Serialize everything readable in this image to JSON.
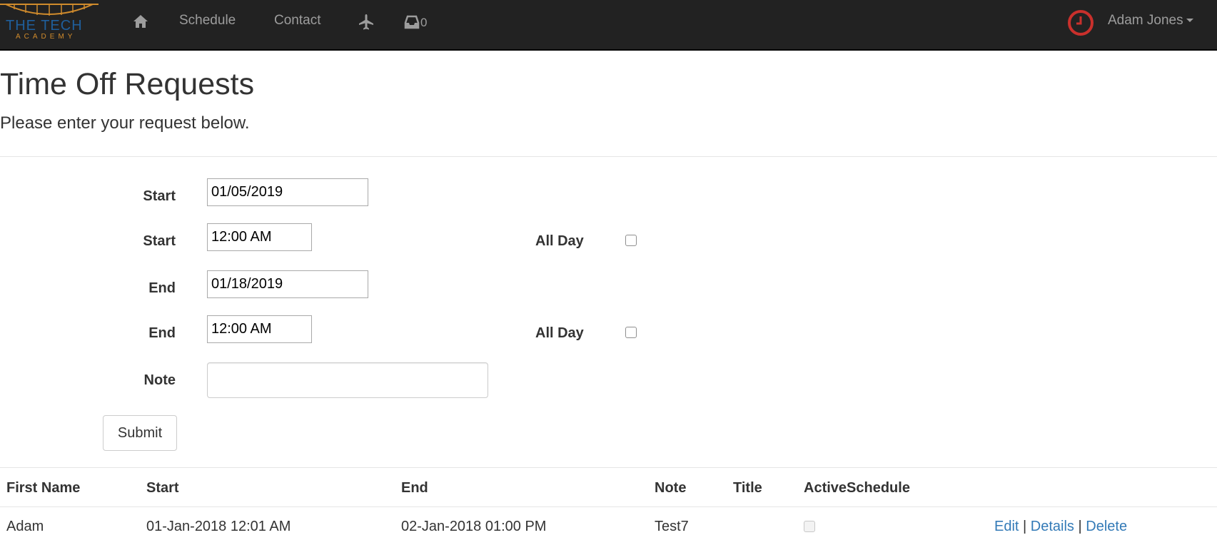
{
  "navbar": {
    "logo": {
      "line1": "THE TECH",
      "line2": "ACADEMY"
    },
    "items": [
      {
        "label": "Schedule"
      },
      {
        "label": "Contact"
      }
    ],
    "inbox_count": "0",
    "user_name": "Adam Jones",
    "icons": [
      "home-icon",
      "airplane-icon",
      "inbox-icon",
      "clock-icon"
    ],
    "colors": {
      "background": "#222222",
      "text": "#9d9d9d",
      "clock": "#c9302c"
    }
  },
  "page": {
    "title": "Time Off Requests",
    "subtitle": "Please enter your request below."
  },
  "form": {
    "start_date_label": "Start",
    "start_date_value": "01/05/2019",
    "start_time_label": "Start",
    "start_time_value": "12:00 AM",
    "start_all_day_label": "All Day",
    "start_all_day_checked": false,
    "end_date_label": "End",
    "end_date_value": "01/18/2019",
    "end_time_label": "End",
    "end_time_value": "12:00 AM",
    "end_all_day_label": "All Day",
    "end_all_day_checked": false,
    "note_label": "Note",
    "note_value": "",
    "submit_label": "Submit"
  },
  "table": {
    "columns": [
      "First Name",
      "Start",
      "End",
      "Note",
      "Title",
      "ActiveSchedule"
    ],
    "rows": [
      {
        "first_name": "Adam",
        "start": "01-Jan-2018 12:01 AM",
        "end": "02-Jan-2018 01:00 PM",
        "note": "Test7",
        "title": "",
        "active_schedule": false,
        "actions": {
          "edit": "Edit",
          "separator": "|",
          "details": "Details",
          "delete": "Delete"
        }
      }
    ],
    "colors": {
      "link": "#337ab7"
    }
  }
}
